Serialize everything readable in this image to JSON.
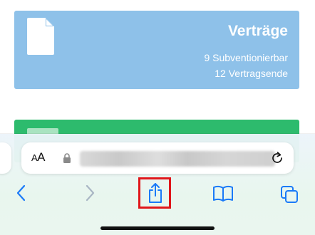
{
  "cards": {
    "contracts": {
      "title": "Verträge",
      "line1": "9 Subventionierbar",
      "line2": "12 Vertragsende",
      "color": "#8ec1e9",
      "icon": "document-icon"
    },
    "second": {
      "color": "#2dbb6d"
    }
  },
  "browser": {
    "text_size_label": "AA",
    "lock_icon": "lock-icon",
    "reload_icon": "reload-icon",
    "toolbar": {
      "back_icon": "chevron-left-icon",
      "forward_icon": "chevron-right-icon",
      "share_icon": "share-icon",
      "bookmarks_icon": "book-icon",
      "tabs_icon": "tabs-icon"
    },
    "accent_color": "#1a7af8",
    "highlight_color": "#e0161a"
  }
}
